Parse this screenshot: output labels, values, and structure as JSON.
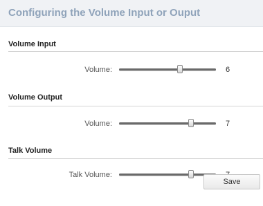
{
  "header": {
    "title": "Configuring the Volume Input or Ouput"
  },
  "sections": [
    {
      "title": "Volume Input",
      "label": "Volume:",
      "value": "6",
      "level": 0.63
    },
    {
      "title": "Volume Output",
      "label": "Volume:",
      "value": "7",
      "level": 0.74
    },
    {
      "title": "Talk Volume",
      "label": "Talk Volume:",
      "value": "7",
      "level": 0.74
    }
  ],
  "actions": {
    "save_label": "Save"
  }
}
